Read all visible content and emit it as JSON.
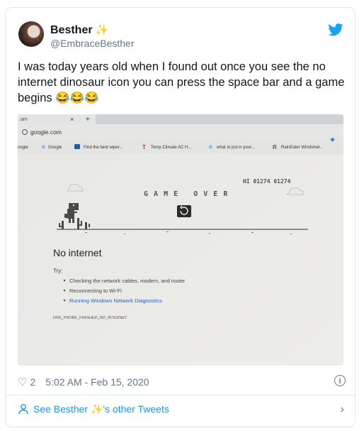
{
  "tweet": {
    "author_name": "Besther",
    "author_sparkle": "✨",
    "handle": "@EmbraceBesther",
    "text": "I was today years old when I found out once you see the no internet dinosaur icon you can press the space bar and a game begins 😂😂😂",
    "likes": "2",
    "timestamp": "5:02 AM - Feb 15, 2020",
    "footer_prefix": "See Besther ",
    "footer_sparkle": "✨",
    "footer_suffix": "'s other Tweets"
  },
  "photo": {
    "tab_label": ".om",
    "tab_close": "×",
    "tab_new": "+",
    "url": "google.com",
    "bookmarks": [
      "oogle",
      "Google",
      "Find the best wiper...",
      "Temp Climate AC H...",
      "what to put in your...",
      "RainEater Windshiel..."
    ],
    "hi_score": "HI 01274 01274",
    "game_over": "G A M E   O V E R",
    "no_internet_title": "No internet",
    "try_label": "Try:",
    "suggestions": [
      "Checking the network cables, modem, and router",
      "Reconnecting to Wi-Fi",
      "Running Windows Network Diagnostics"
    ],
    "error_code": "DNS_PROBE_FINISHED_NO_INTERNET"
  },
  "colors": {
    "link": "#1b95e0",
    "muted": "#657786",
    "border": "#e1e8ed",
    "twitter_blue": "#1da1f2"
  },
  "icons": [
    "twitter-bird-icon",
    "heart-icon",
    "info-icon",
    "person-icon",
    "chevron-right-icon",
    "star-icon",
    "dino-icon",
    "restart-icon"
  ]
}
